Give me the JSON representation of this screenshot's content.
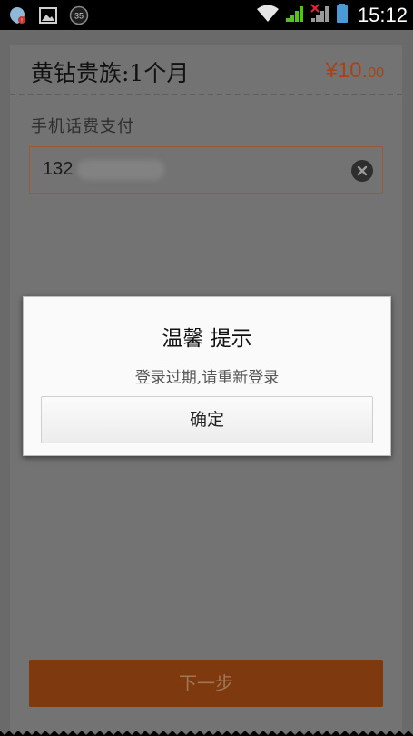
{
  "status_bar": {
    "time": "15:12",
    "notification_badge": "35",
    "icons": [
      "notification-icon",
      "gallery-icon",
      "badge-icon",
      "wifi-icon",
      "signal-icon",
      "no-signal-icon",
      "battery-icon"
    ]
  },
  "header": {
    "title": "黄钻贵族:1个月",
    "price_main": "¥10.",
    "price_cents": "00"
  },
  "payment": {
    "label": "手机话费支付",
    "phone_prefix": "132"
  },
  "next_button": {
    "label": "下一步"
  },
  "dialog": {
    "title": "温馨 提示",
    "message": "登录过期,请重新登录",
    "ok_label": "确定"
  },
  "colors": {
    "accent": "#a5441a",
    "button": "#7e3a0e",
    "overlay_bg": "#6a6a6a"
  }
}
